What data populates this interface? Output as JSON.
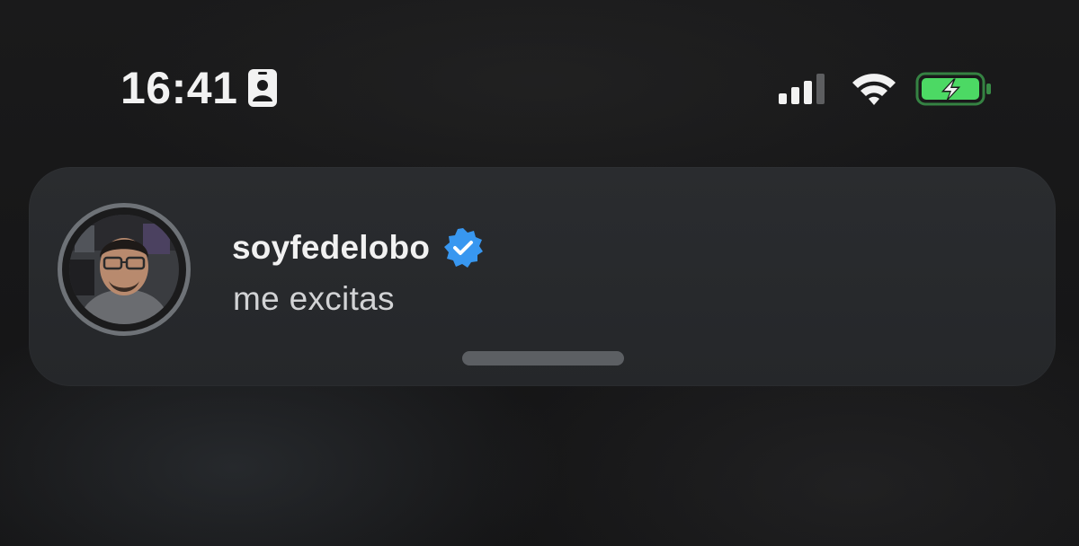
{
  "status_bar": {
    "time": "16:41",
    "focus_icon": "id-badge-icon",
    "signal_icon": "cellular-signal-icon",
    "wifi_icon": "wifi-icon",
    "battery_icon": "battery-charging-icon",
    "battery_color": "#4cd964"
  },
  "notification": {
    "avatar_icon": "profile-photo",
    "sender": "soyfedelobo",
    "verified_icon": "verified-badge-icon",
    "verified_color": "#3897f0",
    "message": "me excitas"
  }
}
